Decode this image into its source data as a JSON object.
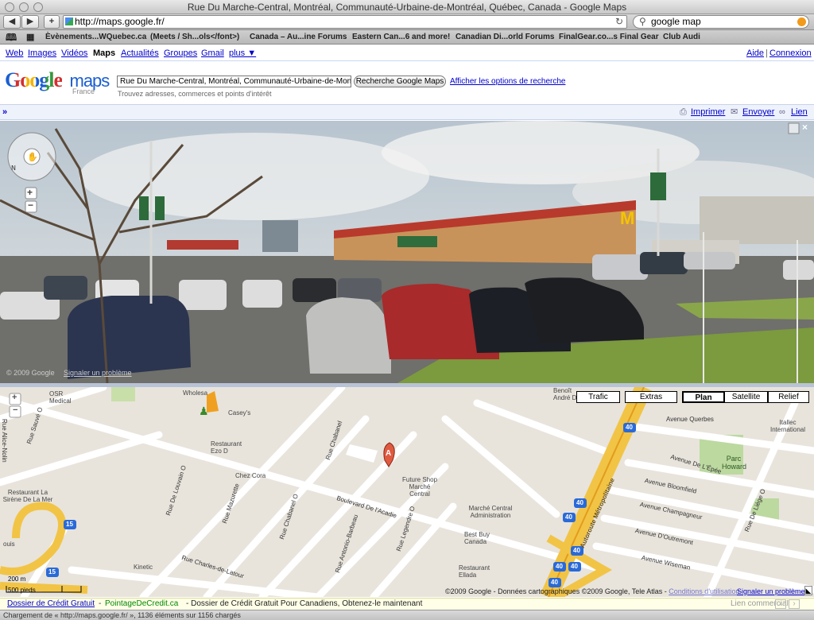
{
  "window": {
    "title": "Rue Du Marche-Central, Montréal, Communauté-Urbaine-de-Montréal, Québec, Canada - Google Maps"
  },
  "toolbar": {
    "back": "◀",
    "forward": "▶",
    "add": "+",
    "url": "http://maps.google.fr/",
    "reload": "↻",
    "search_value": "google map"
  },
  "bookmarks": [
    "Èvènements...WQuebec.ca",
    "(Meets / Sh...ols</font>)",
    "Canada – Au...ine Forums",
    "Eastern Can...6 and more!",
    "Canadian Di...orld Forums",
    "FinalGear.co...s Final Gear",
    "Club Audi"
  ],
  "gbar": {
    "left": [
      "Web",
      "Images",
      "Vidéos",
      "Maps",
      "Actualités",
      "Groupes",
      "Gmail",
      "plus ▼"
    ],
    "help": "Aide",
    "login": "Connexion"
  },
  "header": {
    "logo_word": "Google",
    "logo_product": "maps",
    "logo_region": "France",
    "query": "Rue Du Marche-Central, Montréal, Communauté-Urbaine-de-Montréal, Québec, Canada",
    "search_button": "Recherche Google Maps",
    "options_link": "Afficher les options de recherche",
    "hint": "Trouvez adresses, commerces et points d'intérêt"
  },
  "linkbar": {
    "print": "Imprimer",
    "send": "Envoyer",
    "link": "Lien"
  },
  "streetview": {
    "copyright": "© 2009 Google",
    "report": "Signaler un problème"
  },
  "map": {
    "buttons": [
      "Trafic",
      "Extras",
      "Plan",
      "Satellite",
      "Relief"
    ],
    "scale": {
      "metric": "200 m",
      "imperial": "500 pieds"
    },
    "copyright": "©2009 Google - Données cartographiques ©2009 Google, Tele Atlas - ",
    "terms": "Conditions d'utilisation",
    "report": "Signaler un problème",
    "marker": "A",
    "labels": [
      "OSR Medical",
      "Wholesa",
      "Casey's",
      "Restaurant Ezo D",
      "Chez Cora",
      "Future Shop Marché Central",
      "Marché Central Administration",
      "Best Buy Canada",
      "Restaurant Ellada",
      "Kinetic",
      "Restaurant La Sirène De La Mer",
      "Benoît André D",
      "Itallec International",
      "Parc Howard",
      "ouis"
    ],
    "streets": [
      "Rue Sauvé O",
      "Rue De Louvain O",
      "Rue Mazurette",
      "Rue Chabanel O",
      "Rue Chabanel",
      "Rue Antonio-Barbeau",
      "Rue Legendre O",
      "Boulevard De l'Acadie",
      "Rue Charles-de-Latour",
      "Autoroute Métropolitaine",
      "Avenue Querbes",
      "Avenue De L'Épée",
      "Avenue Bloomfield",
      "Avenue Champagneur",
      "Avenue D'Outremont",
      "Avenue Wiseman",
      "Rue De Liège O",
      "Rue Alice-Nolin"
    ],
    "shields": [
      "40",
      "15"
    ]
  },
  "ad": {
    "title": "Dossier de Crédit Gratuit",
    "domain": "PointageDeCredit.ca",
    "text": "- Dossier de Crédit Gratuit Pour Canadiens, Obtenez-le maintenant",
    "label": "Lien commercial"
  },
  "status": "Chargement de « http://maps.google.fr/ », 1136 éléments sur 1156 chargés"
}
